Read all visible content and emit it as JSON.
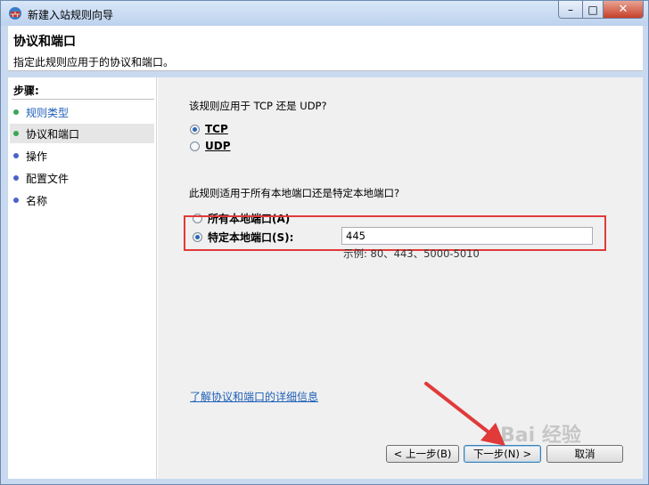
{
  "window": {
    "title": "新建入站规则向导",
    "close_glyph": "✕",
    "max_glyph": "□",
    "min_glyph": "–"
  },
  "header": {
    "title": "协议和端口",
    "description": "指定此规则应用于的协议和端口。"
  },
  "steps": {
    "title": "步骤:",
    "items": [
      {
        "label": "规则类型",
        "color": "#3aa655",
        "link": true
      },
      {
        "label": "协议和端口",
        "color": "#3aa655",
        "active": true
      },
      {
        "label": "操作",
        "color": "#4a63c8"
      },
      {
        "label": "配置文件",
        "color": "#4a63c8"
      },
      {
        "label": "名称",
        "color": "#4a63c8"
      }
    ]
  },
  "protocol": {
    "question": "该规则应用于 TCP 还是 UDP?",
    "options": [
      {
        "label": "TCP",
        "selected": true
      },
      {
        "label": "UDP",
        "selected": false
      }
    ]
  },
  "ports": {
    "question": "此规则适用于所有本地端口还是特定本地端口?",
    "all_ports_label": "所有本地端口(A)",
    "specific_ports_label": "特定本地端口(S):",
    "specific_value": "445",
    "example": "示例: 80、443、5000-5010"
  },
  "link_text": "了解协议和端口的详细信息",
  "buttons": {
    "back": "< 上一步(B)",
    "next": "下一步(N) >",
    "cancel": "取消"
  },
  "watermark": "Bai 经验",
  "colors": {
    "highlight_box": "#e03a3a",
    "link": "#1f5fb8"
  }
}
